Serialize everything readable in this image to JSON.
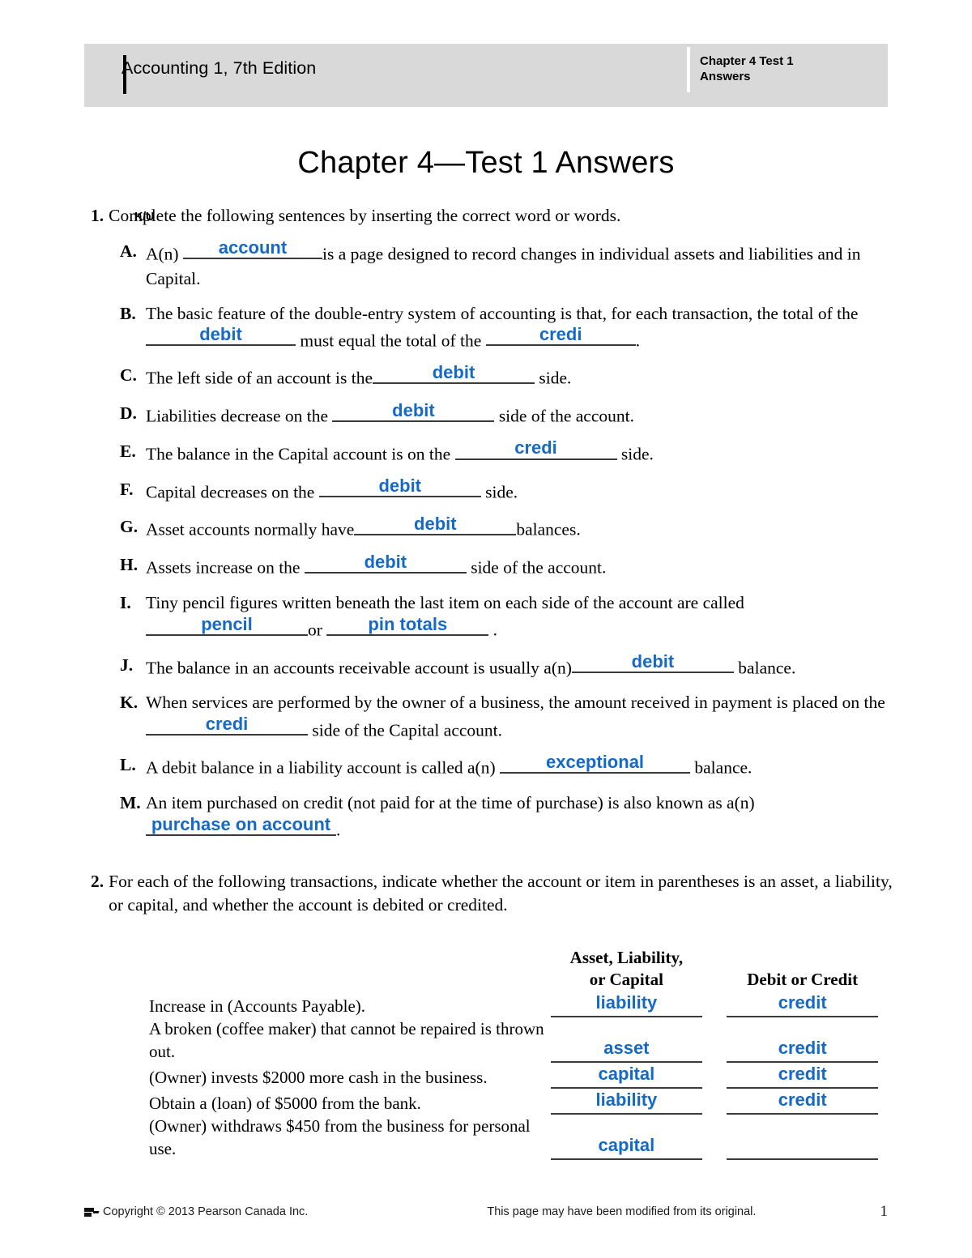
{
  "header": {
    "book_title": "Accounting 1, 7th Edition",
    "chapter_label": "Chapter 4 Test 1\nAnswers"
  },
  "page_title": "Chapter 4—Test 1 Answers",
  "question1": {
    "ku_mark": "K/U",
    "number": "1.",
    "prompt": "Complete the following sentences by inserting the correct word or words.",
    "items": [
      {
        "letter": "A.",
        "text_before": "A(n)",
        "answer": "account",
        "text_after": "is a page designed to record changes in individual assets and liabilities and in Capital."
      },
      {
        "letter": "B.",
        "text_before": "The basic feature of the double-entry system of accounting is that, for each transaction, the total of the",
        "answer": "debit",
        "text_mid": "must equal the total of the",
        "answer2": "credi",
        "text_after": "."
      },
      {
        "letter": "C.",
        "text_before": "The left side of an account is the",
        "answer": "debit",
        "text_after": "side."
      },
      {
        "letter": "D.",
        "text_before": "Liabilities decrease on the",
        "answer": "debit",
        "text_after": "side of the account."
      },
      {
        "letter": "E.",
        "text_before": "The balance in the Capital account is on the",
        "answer": "credi",
        "text_after": "side."
      },
      {
        "letter": "F.",
        "text_before": "Capital decreases on the",
        "answer": "debit",
        "text_after": "side."
      },
      {
        "letter": "G.",
        "text_before": "Asset accounts normally have",
        "answer": "debit",
        "text_after": "balances."
      },
      {
        "letter": "H.",
        "text_before": "Assets increase on the",
        "answer": "debit",
        "text_after": "side of the account."
      },
      {
        "letter": "I.",
        "text_before": "Tiny pencil figures written beneath the last item on each side of the account are called",
        "answer": "pencil",
        "text_mid": "or",
        "answer2": "pin totals",
        "text_after": "."
      },
      {
        "letter": "J.",
        "text_before": "The balance in an accounts receivable account is usually a(n)",
        "answer": "debit",
        "text_after": "balance."
      },
      {
        "letter": "K.",
        "text_before": "When services are performed by the owner of a business, the amount received in payment is placed on the",
        "answer": "credi",
        "text_after": "side of the Capital account."
      },
      {
        "letter": "L.",
        "text_before": "A debit balance in a liability account is called a(n)",
        "answer": "exceptional",
        "text_after": "balance."
      },
      {
        "letter": "M.",
        "text_before": "An item purchased on credit (not paid for at the time of purchase) is also known as a(n)",
        "answer": "purchase on account",
        "text_after": "."
      }
    ]
  },
  "question2": {
    "number": "2.",
    "prompt": "For each of the following transactions, indicate whether the account or item in parentheses is an asset, a liability, or capital, and whether the account is debited or credited.",
    "table": {
      "headers": {
        "description": "",
        "classification_line1": "Asset, Liability,",
        "classification_line2": "or Capital",
        "debit_credit": "Debit or Credit"
      },
      "rows": [
        {
          "description": "Increase in (Accounts Payable).",
          "classification": "liability",
          "debit_credit": "credit"
        },
        {
          "description": "A broken (coffee maker) that cannot be repaired is thrown out.",
          "classification": "asset",
          "debit_credit": "credit"
        },
        {
          "description": "(Owner) invests $2000 more cash in the business.",
          "classification": "capital",
          "debit_credit": "credit"
        },
        {
          "description": "Obtain a (loan) of $5000 from the bank.",
          "classification": "liability",
          "debit_credit": "credit"
        },
        {
          "description": "(Owner) withdraws $450 from the business for personal use.",
          "classification": "capital",
          "debit_credit": ""
        }
      ]
    }
  },
  "footer": {
    "copyright": "Copyright © 2013 Pearson Canada Inc.",
    "note": "This page may have been modified from its original.",
    "page_number": "1"
  },
  "colors": {
    "answer_blue": "#1569c7",
    "header_band": "#d9d9d9",
    "rule": "#3a3a3a"
  }
}
